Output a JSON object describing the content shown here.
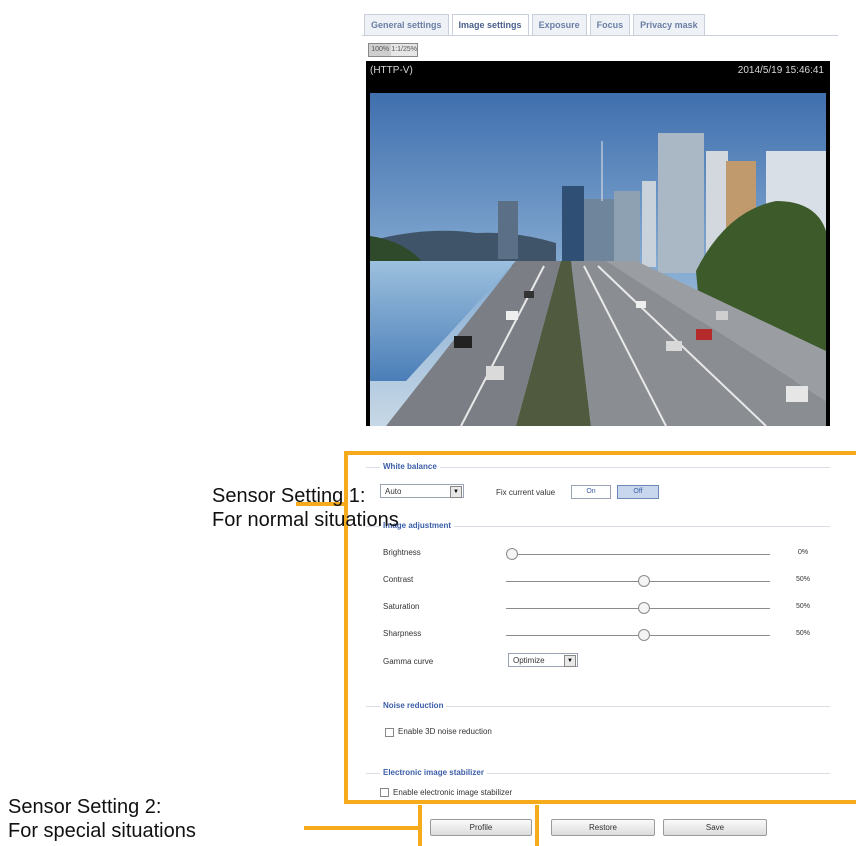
{
  "tabs": [
    {
      "label": "General settings",
      "active": false
    },
    {
      "label": "Image settings",
      "active": true
    },
    {
      "label": "Exposure",
      "active": false
    },
    {
      "label": "Focus",
      "active": false
    },
    {
      "label": "Privacy mask",
      "active": false
    }
  ],
  "zoom": {
    "left": "100%",
    "right": "1:1/25%"
  },
  "video": {
    "stream_label": "(HTTP-V)",
    "timestamp": "2014/5/19 15:46:41"
  },
  "white_balance": {
    "title": "White balance",
    "mode": "Auto",
    "fix_label": "Fix current value",
    "on_label": "On",
    "off_label": "Off"
  },
  "image_adjustment": {
    "title": "Image adjustment",
    "brightness": {
      "label": "Brightness",
      "value": "0%",
      "level": 0.0
    },
    "contrast": {
      "label": "Contrast",
      "value": "50%",
      "level": 0.5
    },
    "saturation": {
      "label": "Saturation",
      "value": "50%",
      "level": 0.5
    },
    "sharpness": {
      "label": "Sharpness",
      "value": "50%",
      "level": 0.5
    },
    "gamma_label": "Gamma curve",
    "gamma_value": "Optimize"
  },
  "noise_reduction": {
    "title": "Noise reduction",
    "checkbox_label": "Enable 3D noise reduction"
  },
  "eis": {
    "title": "Electronic image stabilizer",
    "checkbox_label": "Enable electronic image stabilizer"
  },
  "buttons": {
    "profile": "Profile",
    "restore": "Restore",
    "save": "Save"
  },
  "annotations": {
    "sensor1_line1": "Sensor Setting 1:",
    "sensor1_line2": "For normal situations",
    "sensor2_line1": "Sensor Setting 2:",
    "sensor2_line2": "For special situations"
  },
  "colors": {
    "highlight": "#f5ab1c",
    "section_title": "#3b5ea8"
  }
}
